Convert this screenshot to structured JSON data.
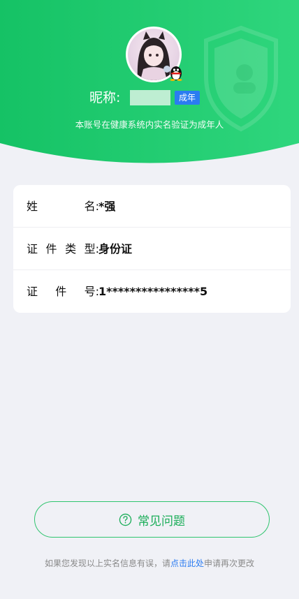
{
  "header": {
    "nickname_label": "昵称:",
    "nickname_value": "",
    "adult_badge": "成年",
    "verify_text": "本账号在健康系统内实名验证为成年人",
    "colors": {
      "gradient_start": "#17c567",
      "gradient_end": "#2cd67a"
    }
  },
  "info": {
    "rows": [
      {
        "label_chars": [
          "姓",
          "名:"
        ],
        "value": "*强"
      },
      {
        "label_chars": [
          "证",
          "件",
          "类",
          "型:"
        ],
        "value": "身份证"
      },
      {
        "label_chars": [
          "证",
          "件",
          "号:"
        ],
        "value": "1****************5"
      }
    ]
  },
  "faq": {
    "label": "常见问题",
    "icon": "question-circle-icon"
  },
  "footer": {
    "text_before": "如果您发现以上实名信息有误，请",
    "link": "点击此处",
    "text_after": "申请再次更改"
  },
  "colors": {
    "accent": "#1aad58",
    "link": "#2b7cf1",
    "badge": "#2b7cf1"
  }
}
